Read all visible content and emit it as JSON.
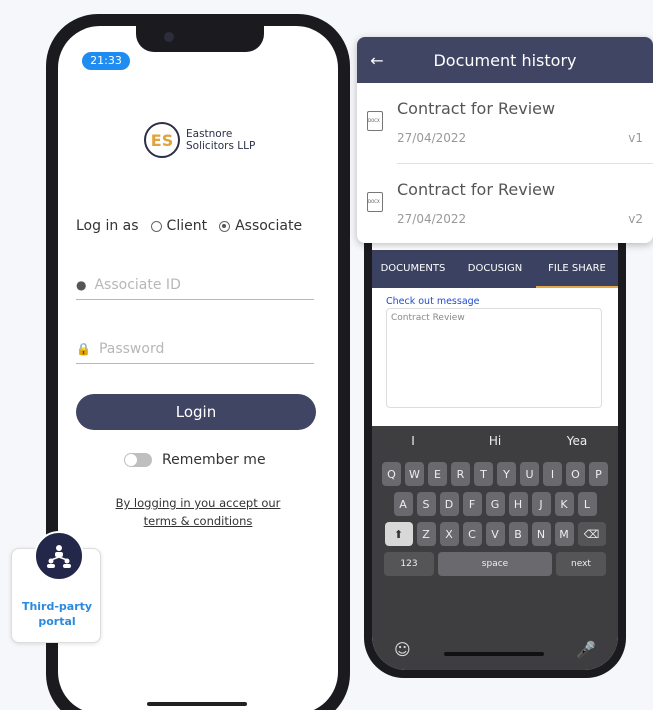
{
  "status": {
    "time": "21:33"
  },
  "brand": {
    "initials": "ES",
    "line1": "Eastnore",
    "line2": "Solicitors LLP"
  },
  "login": {
    "login_as": "Log in as",
    "option_client": "Client",
    "option_associate": "Associate",
    "associate_placeholder": "Associate ID",
    "password_placeholder": "Password",
    "button": "Login",
    "remember": "Remember me",
    "terms_line1": "By logging in you accept our",
    "terms_line2": "terms & conditions"
  },
  "third_party": {
    "line1": "Third-party",
    "line2": "portal"
  },
  "doc_history": {
    "title": "Document history",
    "items": [
      {
        "name": "Contract for Review",
        "date": "27/04/2022",
        "version": "v1"
      },
      {
        "name": "Contract for Review",
        "date": "27/04/2022",
        "version": "v2"
      }
    ]
  },
  "tabs": [
    "DOCUMENTS",
    "DOCUSIGN",
    "FILE SHARE"
  ],
  "message": {
    "label": "Check out message",
    "placeholder": "Contract Review"
  },
  "keyboard": {
    "suggestions": [
      "I",
      "Hi",
      "Yea"
    ],
    "row1": [
      "Q",
      "W",
      "E",
      "R",
      "T",
      "Y",
      "U",
      "I",
      "O",
      "P"
    ],
    "row2": [
      "A",
      "S",
      "D",
      "F",
      "G",
      "H",
      "J",
      "K",
      "L"
    ],
    "row3": [
      "Z",
      "X",
      "C",
      "V",
      "B",
      "N",
      "M"
    ],
    "num_key": "123",
    "space_key": "space",
    "next_key": "next"
  },
  "colors": {
    "navy": "#404563",
    "gold": "#d9b36a",
    "blue": "#1f8cf2"
  }
}
